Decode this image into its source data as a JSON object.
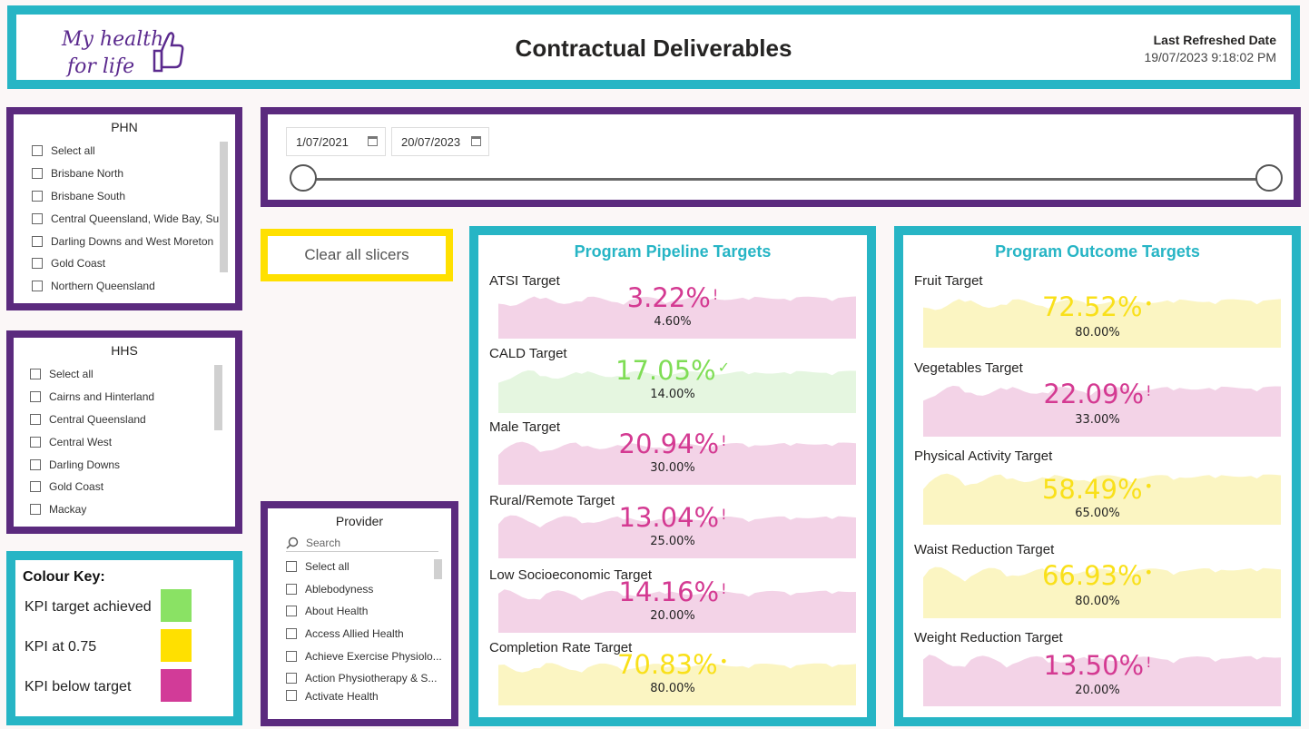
{
  "header": {
    "title": "Contractual Deliverables",
    "logo_line1": "My health",
    "logo_line2": "for life",
    "refresh_label": "Last Refreshed Date",
    "refresh_value": "19/07/2023 9:18:02 PM"
  },
  "phn": {
    "title": "PHN",
    "items": [
      "Select all",
      "Brisbane North",
      "Brisbane South",
      "Central Queensland, Wide Bay, Su...",
      "Darling Downs and West Moreton",
      "Gold Coast",
      "Northern Queensland"
    ]
  },
  "hhs": {
    "title": "HHS",
    "items": [
      "Select all",
      "Cairns and Hinterland",
      "Central Queensland",
      "Central West",
      "Darling Downs",
      "Gold Coast",
      "Mackay"
    ]
  },
  "provider": {
    "title": "Provider",
    "search_placeholder": "Search",
    "items": [
      "Select all",
      "Ablebodyness",
      "About Health",
      "Access Allied Health",
      "Achieve Exercise Physiolo...",
      "Action Physiotherapy & S...",
      "Activate Health"
    ]
  },
  "date_slicer": {
    "start": "1/07/2021",
    "end": "20/07/2023"
  },
  "clear_button": "Clear all slicers",
  "colour_key": {
    "title": "Colour Key:",
    "items": [
      {
        "label": "KPI target achieved",
        "color": "#8ae264"
      },
      {
        "label": "KPI at 0.75",
        "color": "#ffe000"
      },
      {
        "label": "KPI below target",
        "color": "#d23b98"
      }
    ]
  },
  "pipeline": {
    "title": "Program Pipeline Targets",
    "kpis": [
      {
        "label": "ATSI Target",
        "value": "3.22%",
        "goal": "4.60%",
        "status": "pink",
        "indicator": "!"
      },
      {
        "label": "CALD Target",
        "value": "17.05%",
        "goal": "14.00%",
        "status": "green",
        "indicator": "✓"
      },
      {
        "label": "Male Target",
        "value": "20.94%",
        "goal": "30.00%",
        "status": "pink",
        "indicator": "!"
      },
      {
        "label": "Rural/Remote Target",
        "value": "13.04%",
        "goal": "25.00%",
        "status": "pink",
        "indicator": "!"
      },
      {
        "label": "Low Socioeconomic Target",
        "value": "14.16%",
        "goal": "20.00%",
        "status": "pink",
        "indicator": "!"
      },
      {
        "label": "Completion Rate Target",
        "value": "70.83%",
        "goal": "80.00%",
        "status": "yellow",
        "indicator": "•"
      }
    ]
  },
  "outcome": {
    "title": "Program Outcome Targets",
    "kpis": [
      {
        "label": "Fruit Target",
        "value": "72.52%",
        "goal": "80.00%",
        "status": "yellow",
        "indicator": "•"
      },
      {
        "label": "Vegetables Target",
        "value": "22.09%",
        "goal": "33.00%",
        "status": "pink",
        "indicator": "!"
      },
      {
        "label": "Physical Activity Target",
        "value": "58.49%",
        "goal": "65.00%",
        "status": "yellow",
        "indicator": "•"
      },
      {
        "label": "Waist Reduction Target",
        "value": "66.93%",
        "goal": "80.00%",
        "status": "yellow",
        "indicator": "•"
      },
      {
        "label": "Weight Reduction Target",
        "value": "13.50%",
        "goal": "20.00%",
        "status": "pink",
        "indicator": "!"
      }
    ]
  }
}
